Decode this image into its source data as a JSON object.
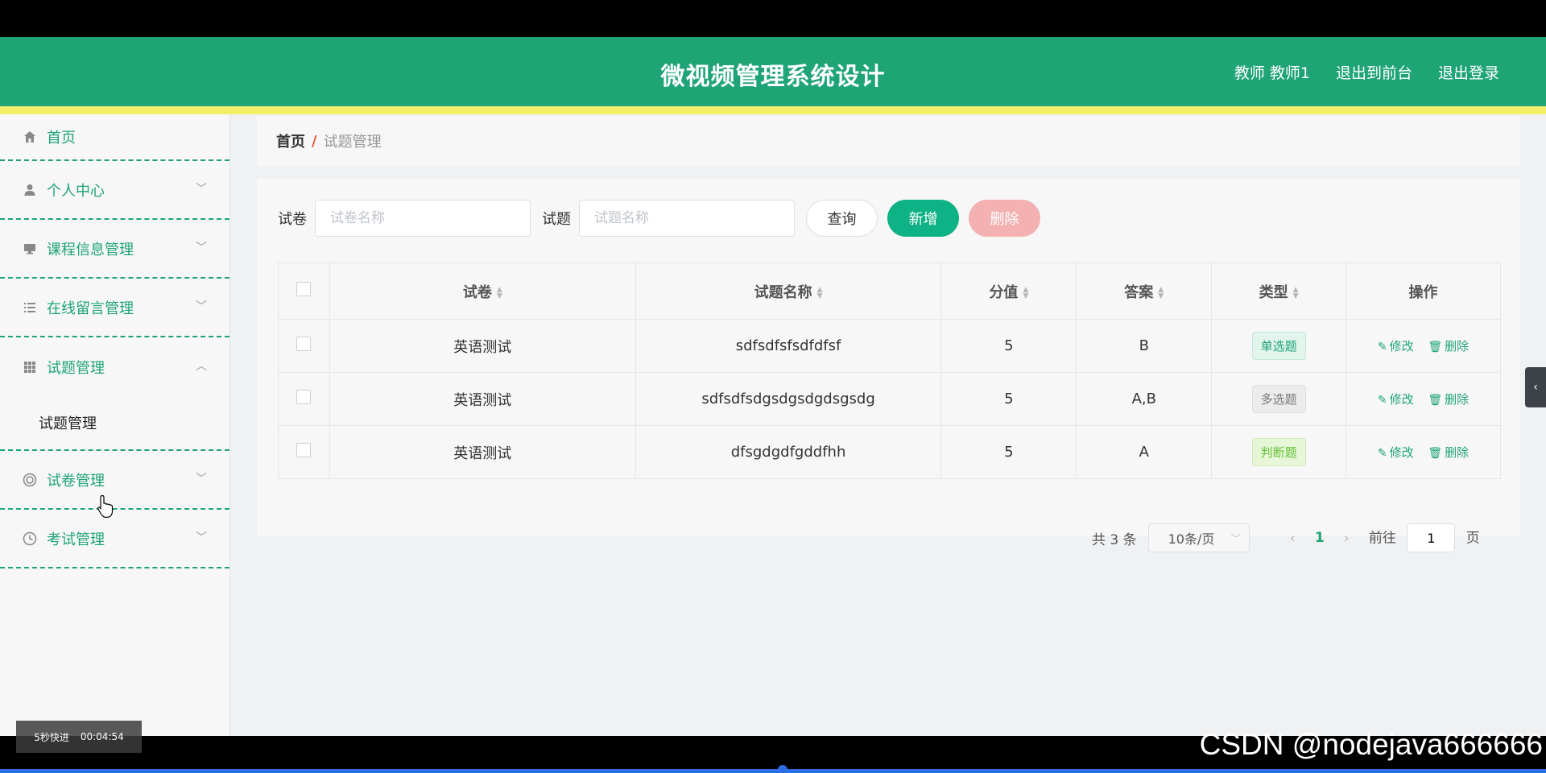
{
  "header": {
    "title": "微视频管理系统设计",
    "user": "教师 教师1",
    "back_to_front": "退出到前台",
    "logout": "退出登录"
  },
  "sidebar": {
    "items": [
      {
        "label": "首页",
        "icon": "home-icon"
      },
      {
        "label": "个人中心",
        "icon": "user-icon"
      },
      {
        "label": "课程信息管理",
        "icon": "monitor-icon"
      },
      {
        "label": "在线留言管理",
        "icon": "list-icon"
      },
      {
        "label": "试题管理",
        "icon": "grid-icon",
        "expanded": true,
        "children": [
          "试题管理"
        ]
      },
      {
        "label": "试卷管理",
        "icon": "target-icon"
      },
      {
        "label": "考试管理",
        "icon": "clock-icon"
      }
    ]
  },
  "breadcrumb": {
    "home": "首页",
    "separator": "/",
    "current": "试题管理"
  },
  "search": {
    "paper_label": "试卷",
    "paper_placeholder": "试卷名称",
    "question_label": "试题",
    "question_placeholder": "试题名称",
    "query_button": "查询",
    "add_button": "新增",
    "delete_button": "删除"
  },
  "table": {
    "columns": [
      "试卷",
      "试题名称",
      "分值",
      "答案",
      "类型",
      "操作"
    ],
    "rows": [
      {
        "paper": "英语测试",
        "name": "sdfsdfsfsdfdfsf",
        "score": "5",
        "answer": "B",
        "type": "单选题"
      },
      {
        "paper": "英语测试",
        "name": "sdfsdfsdgsdgsdgdsgsdg",
        "score": "5",
        "answer": "A,B",
        "type": "多选题"
      },
      {
        "paper": "英语测试",
        "name": "dfsgdgdfgddfhh",
        "score": "5",
        "answer": "A",
        "type": "判断题"
      }
    ],
    "edit_label": "修改",
    "delete_label": "删除"
  },
  "pagination": {
    "total": "共 3 条",
    "page_size": "10条/页",
    "current_page": "1",
    "goto_label": "前往",
    "goto_value": "1",
    "page_suffix": "页"
  },
  "overlay": {
    "speed_label": "5秒快进",
    "time": "00:04:54",
    "watermark": "CSDN @nodejava666666"
  },
  "colors": {
    "primary": "#1ea475",
    "stripe": "#f3ef69",
    "add": "#0fb285",
    "delete": "#f3b1b1"
  }
}
